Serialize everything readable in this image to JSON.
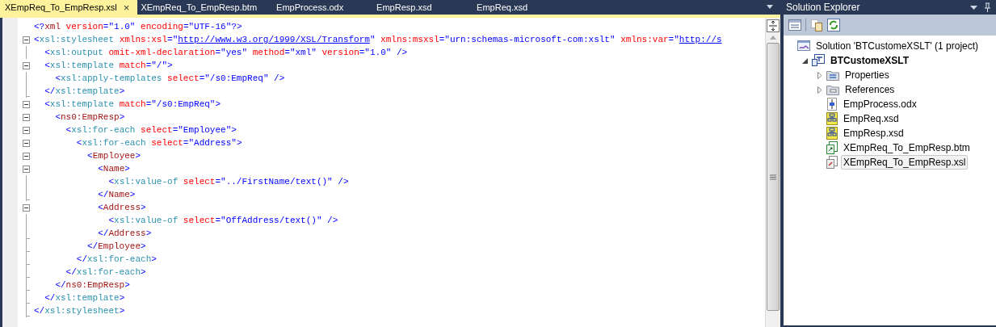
{
  "tabs": [
    {
      "label": "XEmpReq_To_EmpResp.xsl",
      "selected": true,
      "close": "×"
    },
    {
      "label": "XEmpReq_To_EmpResp.btm",
      "selected": false
    },
    {
      "label": "EmpProcess.odx",
      "selected": false
    },
    {
      "label": "EmpResp.xsd",
      "selected": false
    },
    {
      "label": "EmpReq.xsd",
      "selected": false
    }
  ],
  "editor": {
    "lines": [
      {
        "kind": "plain",
        "tokens": [
          {
            "kind": "delim",
            "text": "<?"
          },
          {
            "kind": "elem",
            "text": "xml"
          },
          {
            "kind": "attr",
            "text": " version"
          },
          {
            "kind": "delim",
            "text": "=\""
          },
          {
            "kind": "value",
            "text": "1.0"
          },
          {
            "kind": "delim",
            "text": "\""
          },
          {
            "kind": "attr",
            "text": " encoding"
          },
          {
            "kind": "delim",
            "text": "=\""
          },
          {
            "kind": "value",
            "text": "UTF-16"
          },
          {
            "kind": "delim",
            "text": "\"?>"
          }
        ]
      },
      {
        "kind": "start",
        "tokens": [
          {
            "kind": "delim",
            "text": "<"
          },
          {
            "kind": "xsl",
            "text": "xsl:stylesheet"
          },
          {
            "kind": "attr",
            "text": " xmlns:xsl"
          },
          {
            "kind": "delim",
            "text": "=\""
          },
          {
            "kind": "link",
            "text": "http://www.w3.org/1999/XSL/Transform"
          },
          {
            "kind": "delim",
            "text": "\""
          },
          {
            "kind": "attr",
            "text": " xmlns:msxsl"
          },
          {
            "kind": "delim",
            "text": "=\""
          },
          {
            "kind": "value",
            "text": "urn:schemas-microsoft-com:xslt"
          },
          {
            "kind": "delim",
            "text": "\""
          },
          {
            "kind": "attr",
            "text": " xmlns:var"
          },
          {
            "kind": "delim",
            "text": "=\""
          },
          {
            "kind": "link",
            "text": "http://s"
          }
        ]
      },
      {
        "kind": "body",
        "tokens": [
          {
            "kind": "delim",
            "text": "  <"
          },
          {
            "kind": "xsl",
            "text": "xsl:output"
          },
          {
            "kind": "attr",
            "text": " omit-xml-declaration"
          },
          {
            "kind": "delim",
            "text": "=\""
          },
          {
            "kind": "value",
            "text": "yes"
          },
          {
            "kind": "delim",
            "text": "\""
          },
          {
            "kind": "attr",
            "text": " method"
          },
          {
            "kind": "delim",
            "text": "=\""
          },
          {
            "kind": "value",
            "text": "xml"
          },
          {
            "kind": "delim",
            "text": "\""
          },
          {
            "kind": "attr",
            "text": " version"
          },
          {
            "kind": "delim",
            "text": "=\""
          },
          {
            "kind": "value",
            "text": "1.0"
          },
          {
            "kind": "delim",
            "text": "\" />"
          }
        ]
      },
      {
        "kind": "start",
        "tokens": [
          {
            "kind": "delim",
            "text": "  <"
          },
          {
            "kind": "xsl",
            "text": "xsl:template"
          },
          {
            "kind": "attr",
            "text": " match"
          },
          {
            "kind": "delim",
            "text": "=\""
          },
          {
            "kind": "value",
            "text": "/"
          },
          {
            "kind": "delim",
            "text": "\">"
          }
        ]
      },
      {
        "kind": "body",
        "tokens": [
          {
            "kind": "delim",
            "text": "    <"
          },
          {
            "kind": "xsl",
            "text": "xsl:apply-templates"
          },
          {
            "kind": "attr",
            "text": " select"
          },
          {
            "kind": "delim",
            "text": "=\""
          },
          {
            "kind": "value",
            "text": "/s0:EmpReq"
          },
          {
            "kind": "delim",
            "text": "\" />"
          }
        ]
      },
      {
        "kind": "end",
        "tokens": [
          {
            "kind": "delim",
            "text": "  </"
          },
          {
            "kind": "xsl",
            "text": "xsl:template"
          },
          {
            "kind": "delim",
            "text": ">"
          }
        ]
      },
      {
        "kind": "start",
        "tokens": [
          {
            "kind": "delim",
            "text": "  <"
          },
          {
            "kind": "xsl",
            "text": "xsl:template"
          },
          {
            "kind": "attr",
            "text": " match"
          },
          {
            "kind": "delim",
            "text": "=\""
          },
          {
            "kind": "value",
            "text": "/s0:EmpReq"
          },
          {
            "kind": "delim",
            "text": "\">"
          }
        ]
      },
      {
        "kind": "start",
        "tokens": [
          {
            "kind": "delim",
            "text": "    <"
          },
          {
            "kind": "elem",
            "text": "ns0:EmpResp"
          },
          {
            "kind": "delim",
            "text": ">"
          }
        ]
      },
      {
        "kind": "start",
        "tokens": [
          {
            "kind": "delim",
            "text": "      <"
          },
          {
            "kind": "xsl",
            "text": "xsl:for-each"
          },
          {
            "kind": "attr",
            "text": " select"
          },
          {
            "kind": "delim",
            "text": "=\""
          },
          {
            "kind": "value",
            "text": "Employee"
          },
          {
            "kind": "delim",
            "text": "\">"
          }
        ]
      },
      {
        "kind": "start",
        "tokens": [
          {
            "kind": "delim",
            "text": "        <"
          },
          {
            "kind": "xsl",
            "text": "xsl:for-each"
          },
          {
            "kind": "attr",
            "text": " select"
          },
          {
            "kind": "delim",
            "text": "=\""
          },
          {
            "kind": "value",
            "text": "Address"
          },
          {
            "kind": "delim",
            "text": "\">"
          }
        ]
      },
      {
        "kind": "start",
        "tokens": [
          {
            "kind": "delim",
            "text": "          <"
          },
          {
            "kind": "elem",
            "text": "Employee"
          },
          {
            "kind": "delim",
            "text": ">"
          }
        ]
      },
      {
        "kind": "start",
        "tokens": [
          {
            "kind": "delim",
            "text": "            <"
          },
          {
            "kind": "elem",
            "text": "Name"
          },
          {
            "kind": "delim",
            "text": ">"
          }
        ]
      },
      {
        "kind": "body",
        "tokens": [
          {
            "kind": "delim",
            "text": "              <"
          },
          {
            "kind": "xsl",
            "text": "xsl:value-of"
          },
          {
            "kind": "attr",
            "text": " select"
          },
          {
            "kind": "delim",
            "text": "=\""
          },
          {
            "kind": "value",
            "text": "../FirstName/text()"
          },
          {
            "kind": "delim",
            "text": "\" />"
          }
        ]
      },
      {
        "kind": "end",
        "tokens": [
          {
            "kind": "delim",
            "text": "            </"
          },
          {
            "kind": "elem",
            "text": "Name"
          },
          {
            "kind": "delim",
            "text": ">"
          }
        ]
      },
      {
        "kind": "start",
        "tokens": [
          {
            "kind": "delim",
            "text": "            <"
          },
          {
            "kind": "elem",
            "text": "Address"
          },
          {
            "kind": "delim",
            "text": ">"
          }
        ]
      },
      {
        "kind": "body",
        "tokens": [
          {
            "kind": "delim",
            "text": "              <"
          },
          {
            "kind": "xsl",
            "text": "xsl:value-of"
          },
          {
            "kind": "attr",
            "text": " select"
          },
          {
            "kind": "delim",
            "text": "=\""
          },
          {
            "kind": "value",
            "text": "OffAddress/text()"
          },
          {
            "kind": "delim",
            "text": "\" />"
          }
        ]
      },
      {
        "kind": "end",
        "tokens": [
          {
            "kind": "delim",
            "text": "            </"
          },
          {
            "kind": "elem",
            "text": "Address"
          },
          {
            "kind": "delim",
            "text": ">"
          }
        ]
      },
      {
        "kind": "end",
        "tokens": [
          {
            "kind": "delim",
            "text": "          </"
          },
          {
            "kind": "elem",
            "text": "Employee"
          },
          {
            "kind": "delim",
            "text": ">"
          }
        ]
      },
      {
        "kind": "end",
        "tokens": [
          {
            "kind": "delim",
            "text": "        </"
          },
          {
            "kind": "xsl",
            "text": "xsl:for-each"
          },
          {
            "kind": "delim",
            "text": ">"
          }
        ]
      },
      {
        "kind": "end",
        "tokens": [
          {
            "kind": "delim",
            "text": "      </"
          },
          {
            "kind": "xsl",
            "text": "xsl:for-each"
          },
          {
            "kind": "delim",
            "text": ">"
          }
        ]
      },
      {
        "kind": "end",
        "tokens": [
          {
            "kind": "delim",
            "text": "    </"
          },
          {
            "kind": "elem",
            "text": "ns0:EmpResp"
          },
          {
            "kind": "delim",
            "text": ">"
          }
        ]
      },
      {
        "kind": "end",
        "tokens": [
          {
            "kind": "delim",
            "text": "  </"
          },
          {
            "kind": "xsl",
            "text": "xsl:template"
          },
          {
            "kind": "delim",
            "text": ">"
          }
        ]
      },
      {
        "kind": "end",
        "tokens": [
          {
            "kind": "delim",
            "text": "</"
          },
          {
            "kind": "xsl",
            "text": "xsl:stylesheet"
          },
          {
            "kind": "delim",
            "text": ">"
          }
        ]
      }
    ]
  },
  "solution_explorer": {
    "title": "Solution Explorer",
    "tree": [
      {
        "label": "Solution 'BTCustomeXSLT' (1 project)",
        "kind": "solution",
        "selected": false,
        "children": [
          {
            "label": "BTCustomeXSLT",
            "kind": "project",
            "expanded": true,
            "selected": false,
            "children": [
              {
                "label": "Properties",
                "kind": "properties",
                "expanded": false,
                "selected": false
              },
              {
                "label": "References",
                "kind": "references",
                "expanded": false,
                "selected": false
              },
              {
                "label": "EmpProcess.odx",
                "kind": "orchestration",
                "selected": false
              },
              {
                "label": "EmpReq.xsd",
                "kind": "schema",
                "selected": false
              },
              {
                "label": "EmpResp.xsd",
                "kind": "schema",
                "selected": false
              },
              {
                "label": "XEmpReq_To_EmpResp.btm",
                "kind": "map",
                "selected": false
              },
              {
                "label": "XEmpReq_To_EmpResp.xsl",
                "kind": "stylesheet",
                "selected": true
              }
            ]
          }
        ]
      }
    ]
  }
}
